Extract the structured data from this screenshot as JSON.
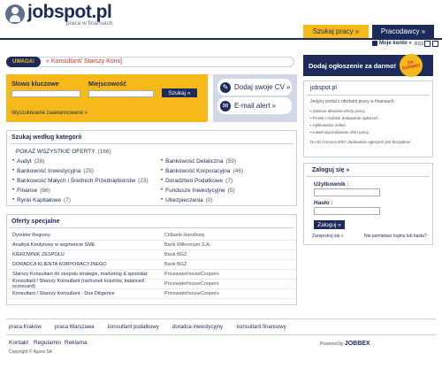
{
  "header": {
    "logo_text": "jobspot.pl",
    "tagline": "praca w finansach",
    "tab_search": "Szukaj pracy »",
    "tab_employers": "Pracodawcy »",
    "account_label": "Moje konto »",
    "rss": "RSS"
  },
  "alert": {
    "badge": "UWAGA!",
    "text": "» Konsultant/ Starszy Kons]"
  },
  "search": {
    "keyword_label": "Słowo kluczowe",
    "location_label": "Miejscowość",
    "button": "Szukaj »",
    "advanced": "Wyszukiwanie zaawansowane »",
    "keyword_value": "",
    "location_value": ""
  },
  "cv": {
    "add_cv": "Dodaj swoje CV »",
    "email_alert": "E-mail alert »"
  },
  "categories": {
    "title": "Szukaj według kategorii",
    "all_label": "POKAŻ WSZYSTKIE OFERTY",
    "all_count": "(166)",
    "left": [
      {
        "name": "Audyt",
        "count": "(28)"
      },
      {
        "name": "Bankowość Inwestycyjna",
        "count": "(25)"
      },
      {
        "name": "Bankowość Małych i Średnich Przedsiębiorstw",
        "count": "(23)"
      },
      {
        "name": "Finanse",
        "count": "(66)"
      },
      {
        "name": "Rynki Kapitałowe",
        "count": "(7)"
      }
    ],
    "right": [
      {
        "name": "Bankowość Detaliczna",
        "count": "(59)"
      },
      {
        "name": "Bankowość Korporacyjna",
        "count": "(46)"
      },
      {
        "name": "Doradztwo Podatkowe",
        "count": "(7)"
      },
      {
        "name": "Fundusze Inwestycyjne",
        "count": "(5)"
      },
      {
        "name": "Ubezpieczenia",
        "count": "(0)"
      }
    ]
  },
  "offers": {
    "title": "Oferty specjalne",
    "rows": [
      {
        "title": "Dyrektor Regionu",
        "company": "Citibank Handlowy"
      },
      {
        "title": "Analityk Kredytowy w segmencie SME",
        "company": "Bank Millennium S.A."
      },
      {
        "title": "KIEROWNIK ZESPOŁU",
        "company": "Bank BGŻ"
      },
      {
        "title": "DORADCA KLIENTA KORPORACYJNEGO",
        "company": "Bank BGŻ"
      },
      {
        "title": "Starszy Konsultant do zespołu strategie, marketing & sprzedaż",
        "company": "PricewaterhouseCoopers"
      },
      {
        "title": "Konsultant / Starszy Konsultant (rachunek kosztów, balanced scorecard)",
        "company": "PricewaterhouseCoopers"
      },
      {
        "title": "Konsultant / Starszy Konsultant - Due Diligence",
        "company": "PricewaterhouseCoopers"
      }
    ]
  },
  "right": {
    "add_offer": "Dodaj ogłoszenie za darmo!",
    "za_darmo": "ZA DARMO!",
    "info_title": "jobspot.pl",
    "info_desc": "Jedyny portal z ofertami pracy w finansach.",
    "bullets": [
      "Zawsze aktualne oferty pracy.",
      "Proste i szybkie dodawanie ogłoszeń.",
      "Aplikowanie online.",
      "Łatwe wyszukiwanie ofert pracy."
    ],
    "info_date": "Do 30 czerwca 2007 dodawanie ogłoszeń jest bezpłatne!"
  },
  "login": {
    "title": "Zaloguj się »",
    "user_label": "Użytkownik :",
    "pass_label": "Hasło :",
    "button": "Zaloguj »",
    "register": "Zarejestruj się »",
    "forgot": "Nie pamiętasz loginu lub hasła?"
  },
  "footer": {
    "links": [
      "praca Kraków",
      "praca Warszawa",
      "konsultant podatkowy",
      "doradca inwestycyjny",
      "konsultant finansowy"
    ],
    "bottom": [
      "Kontakt",
      "Regulamin",
      "Reklama"
    ],
    "powered_label": "Powered by",
    "powered_brand": "JOBBEX",
    "copyright": "Copyright © Agora SA"
  },
  "colors": {
    "navy": "#1c2b5a",
    "yellow": "#f7b91a",
    "alert_red": "#d0302a"
  }
}
